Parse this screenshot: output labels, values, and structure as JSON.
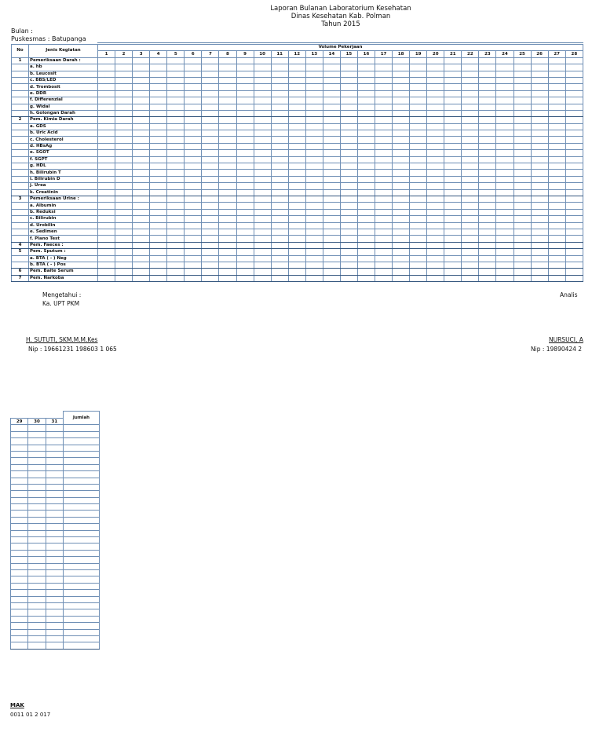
{
  "report": {
    "title_line1": "Laporan Bulanan Laboratorium Kesehatan",
    "title_line2": "Dinas Kesehatan Kab. Polman",
    "title_line3": "Tahun 2015",
    "bulan_label": "Bulan        :",
    "puskesmas_label": "Puskesmas : Batupanga"
  },
  "table": {
    "col_no": "No",
    "col_jenis": "Jenis Kegiatan",
    "col_volume": "Volume Pekerjaan",
    "days": [
      "1",
      "2",
      "3",
      "4",
      "5",
      "6",
      "7",
      "8",
      "9",
      "10",
      "11",
      "12",
      "13",
      "14",
      "15",
      "16",
      "17",
      "18",
      "19",
      "20",
      "21",
      "22",
      "23",
      "24",
      "25",
      "26",
      "27",
      "28"
    ],
    "rows": [
      {
        "no": "1",
        "label": "Pemeriksaan Darah :"
      },
      {
        "no": "",
        "label": "a. hb"
      },
      {
        "no": "",
        "label": "b. Leucosit"
      },
      {
        "no": "",
        "label": "c. BBS/LED"
      },
      {
        "no": "",
        "label": "d. Trombosit"
      },
      {
        "no": "",
        "label": "e. DDR"
      },
      {
        "no": "",
        "label": "f. Differenzial"
      },
      {
        "no": "",
        "label": "g. Widal"
      },
      {
        "no": "",
        "label": "h. Golongan Darah"
      },
      {
        "no": "2",
        "label": "Pem. Kimia Darah"
      },
      {
        "no": "",
        "label": "a. GDS"
      },
      {
        "no": "",
        "label": "b. Uric Acid"
      },
      {
        "no": "",
        "label": "c. Cholesterol"
      },
      {
        "no": "",
        "label": "d. HBsAg"
      },
      {
        "no": "",
        "label": "e. SGOT"
      },
      {
        "no": "",
        "label": "f. SGPT"
      },
      {
        "no": "",
        "label": "g. HDL"
      },
      {
        "no": "",
        "label": "h. Bilirubin T"
      },
      {
        "no": "",
        "label": "i. Bilirubin D"
      },
      {
        "no": "",
        "label": "j. Urea"
      },
      {
        "no": "",
        "label": "k. Creatinin"
      },
      {
        "no": "3",
        "label": "Pemeriksaan Urine :"
      },
      {
        "no": "",
        "label": "a. Albumin"
      },
      {
        "no": "",
        "label": "b. Reduksi"
      },
      {
        "no": "",
        "label": "c. Bilirubin"
      },
      {
        "no": "",
        "label": "d. Urobilin"
      },
      {
        "no": "",
        "label": "e. Sedimen"
      },
      {
        "no": "",
        "label": "f. Plano Test"
      },
      {
        "no": "4",
        "label": "Pem. Faeces :"
      },
      {
        "no": "5",
        "label": "Pem. Sputum :"
      },
      {
        "no": "",
        "label": "a. BTA ( - ) Neg"
      },
      {
        "no": "",
        "label": "b. BTA ( - ) Pos"
      },
      {
        "no": "6",
        "label": "Pem. Baite Serum"
      },
      {
        "no": "7",
        "label": "Pem. Narkoba"
      }
    ]
  },
  "footer": {
    "mengetahui": "Mengetahui :",
    "ka_upt": "Ka. UPT PKM",
    "analis": "Analis",
    "left_name": "H. SUTUTI, SKM.M.M.Kes",
    "left_nip": "Nip : 19661231 198603 1 065",
    "right_name": "NURSUCI, A",
    "right_nip": "Nip : 19890424 2"
  },
  "continuation": {
    "days": [
      "29",
      "30",
      "31"
    ],
    "jumlah": "Jumlah",
    "name_fragment": "MAK",
    "nip_fragment": "0011 01 2 017"
  }
}
